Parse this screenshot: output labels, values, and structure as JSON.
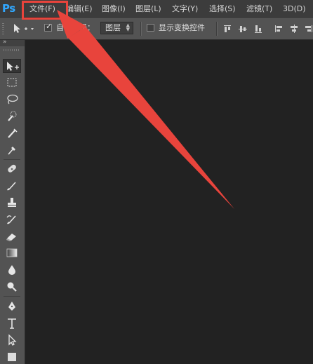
{
  "app": {
    "logo": "Ps"
  },
  "menu": {
    "items": [
      "文件(F)",
      "编辑(E)",
      "图像(I)",
      "图层(L)",
      "文字(Y)",
      "选择(S)",
      "滤镜(T)",
      "3D(D)"
    ]
  },
  "options_bar": {
    "auto_select_label": "自动选择：",
    "auto_select_checked": true,
    "auto_select_target": "图层",
    "show_transform_label": "显示变换控件",
    "show_transform_checked": false
  },
  "toolbox": {
    "header_icon": "double-chevron-icon",
    "tools": [
      "move-tool-icon",
      "rectangular-marquee-icon",
      "lasso-icon",
      "quick-selection-icon",
      "crop-icon",
      "eyedropper-icon",
      "spot-healing-icon",
      "brush-icon",
      "clone-stamp-icon",
      "history-brush-icon",
      "eraser-icon",
      "gradient-icon",
      "blur-icon",
      "dodge-icon",
      "pen-icon",
      "type-icon",
      "path-selection-icon",
      "rectangle-shape-icon"
    ]
  },
  "annotation": {
    "color": "#e8443c"
  },
  "colors": {
    "ps_blue": "#31a8ff",
    "canvas": "#222222",
    "panel": "#535353",
    "menubar": "#3c3c3c"
  }
}
